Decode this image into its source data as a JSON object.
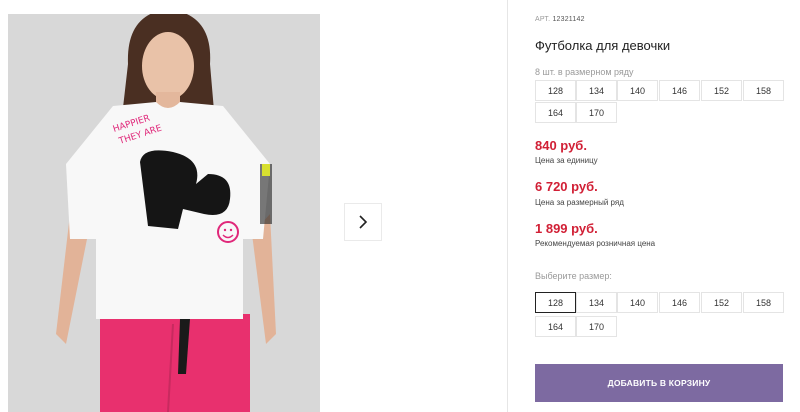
{
  "gallery": {
    "photo_alt": "girl in white graphic t-shirt",
    "next_icon": "chevron-right-icon"
  },
  "product": {
    "article_prefix": "АРТ.",
    "article_number": "12321142",
    "title": "Футболка для девочки",
    "pack_label": "8 шт. в размерном ряду",
    "pack_sizes": [
      "128",
      "134",
      "140",
      "146",
      "152",
      "158",
      "164",
      "170"
    ],
    "price_unit": "840 руб.",
    "price_unit_label": "Цена за единицу",
    "price_row": "6 720 руб.",
    "price_row_label": "Цена за размерный ряд",
    "price_retail": "1 899 руб.",
    "price_retail_label": "Рекомендуемая розничная цена",
    "size_select_label": "Выберите размер:",
    "sizes": [
      "128",
      "134",
      "140",
      "146",
      "152",
      "158",
      "164",
      "170"
    ],
    "selected_size": "128",
    "add_to_cart": "ДОБАВИТЬ В КОРЗИНУ"
  },
  "colors": {
    "price": "#d11f35",
    "button": "#7d6aa1",
    "pants": "#e8306e"
  }
}
